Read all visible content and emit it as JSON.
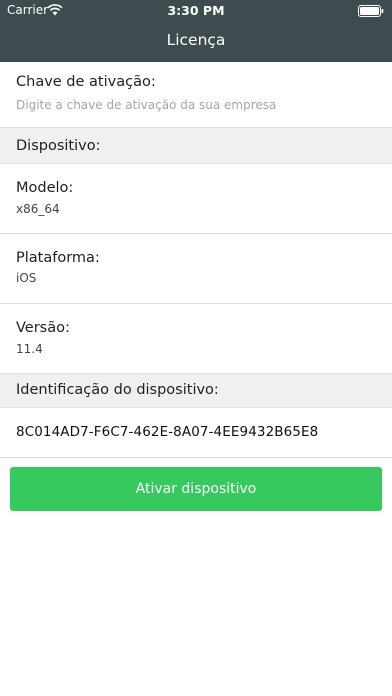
{
  "status_bar": {
    "carrier": "Carrier",
    "time": "3:30 PM",
    "wifi_icon": "wifi-icon",
    "battery_icon": "battery-icon"
  },
  "nav": {
    "title": "Licença"
  },
  "activation": {
    "label": "Chave de ativação:",
    "placeholder": "Digite a chave de ativação da sua empresa"
  },
  "device_section": {
    "header": "Dispositivo:"
  },
  "device": {
    "model": {
      "label": "Modelo:",
      "value": "x86_64"
    },
    "platform": {
      "label": "Plataforma:",
      "value": "iOS"
    },
    "version": {
      "label": "Versão:",
      "value": "11.4"
    }
  },
  "device_id_section": {
    "header": "Identificação do dispositivo:"
  },
  "device_id": {
    "value": "8C014AD7-F6C7-462E-8A07-4EE9432B65E8"
  },
  "actions": {
    "activate_label": "Ativar dispositivo"
  },
  "colors": {
    "header_bg": "#3f4c4f",
    "section_bg": "#f0f0f0",
    "button_bg": "#35c95e"
  }
}
